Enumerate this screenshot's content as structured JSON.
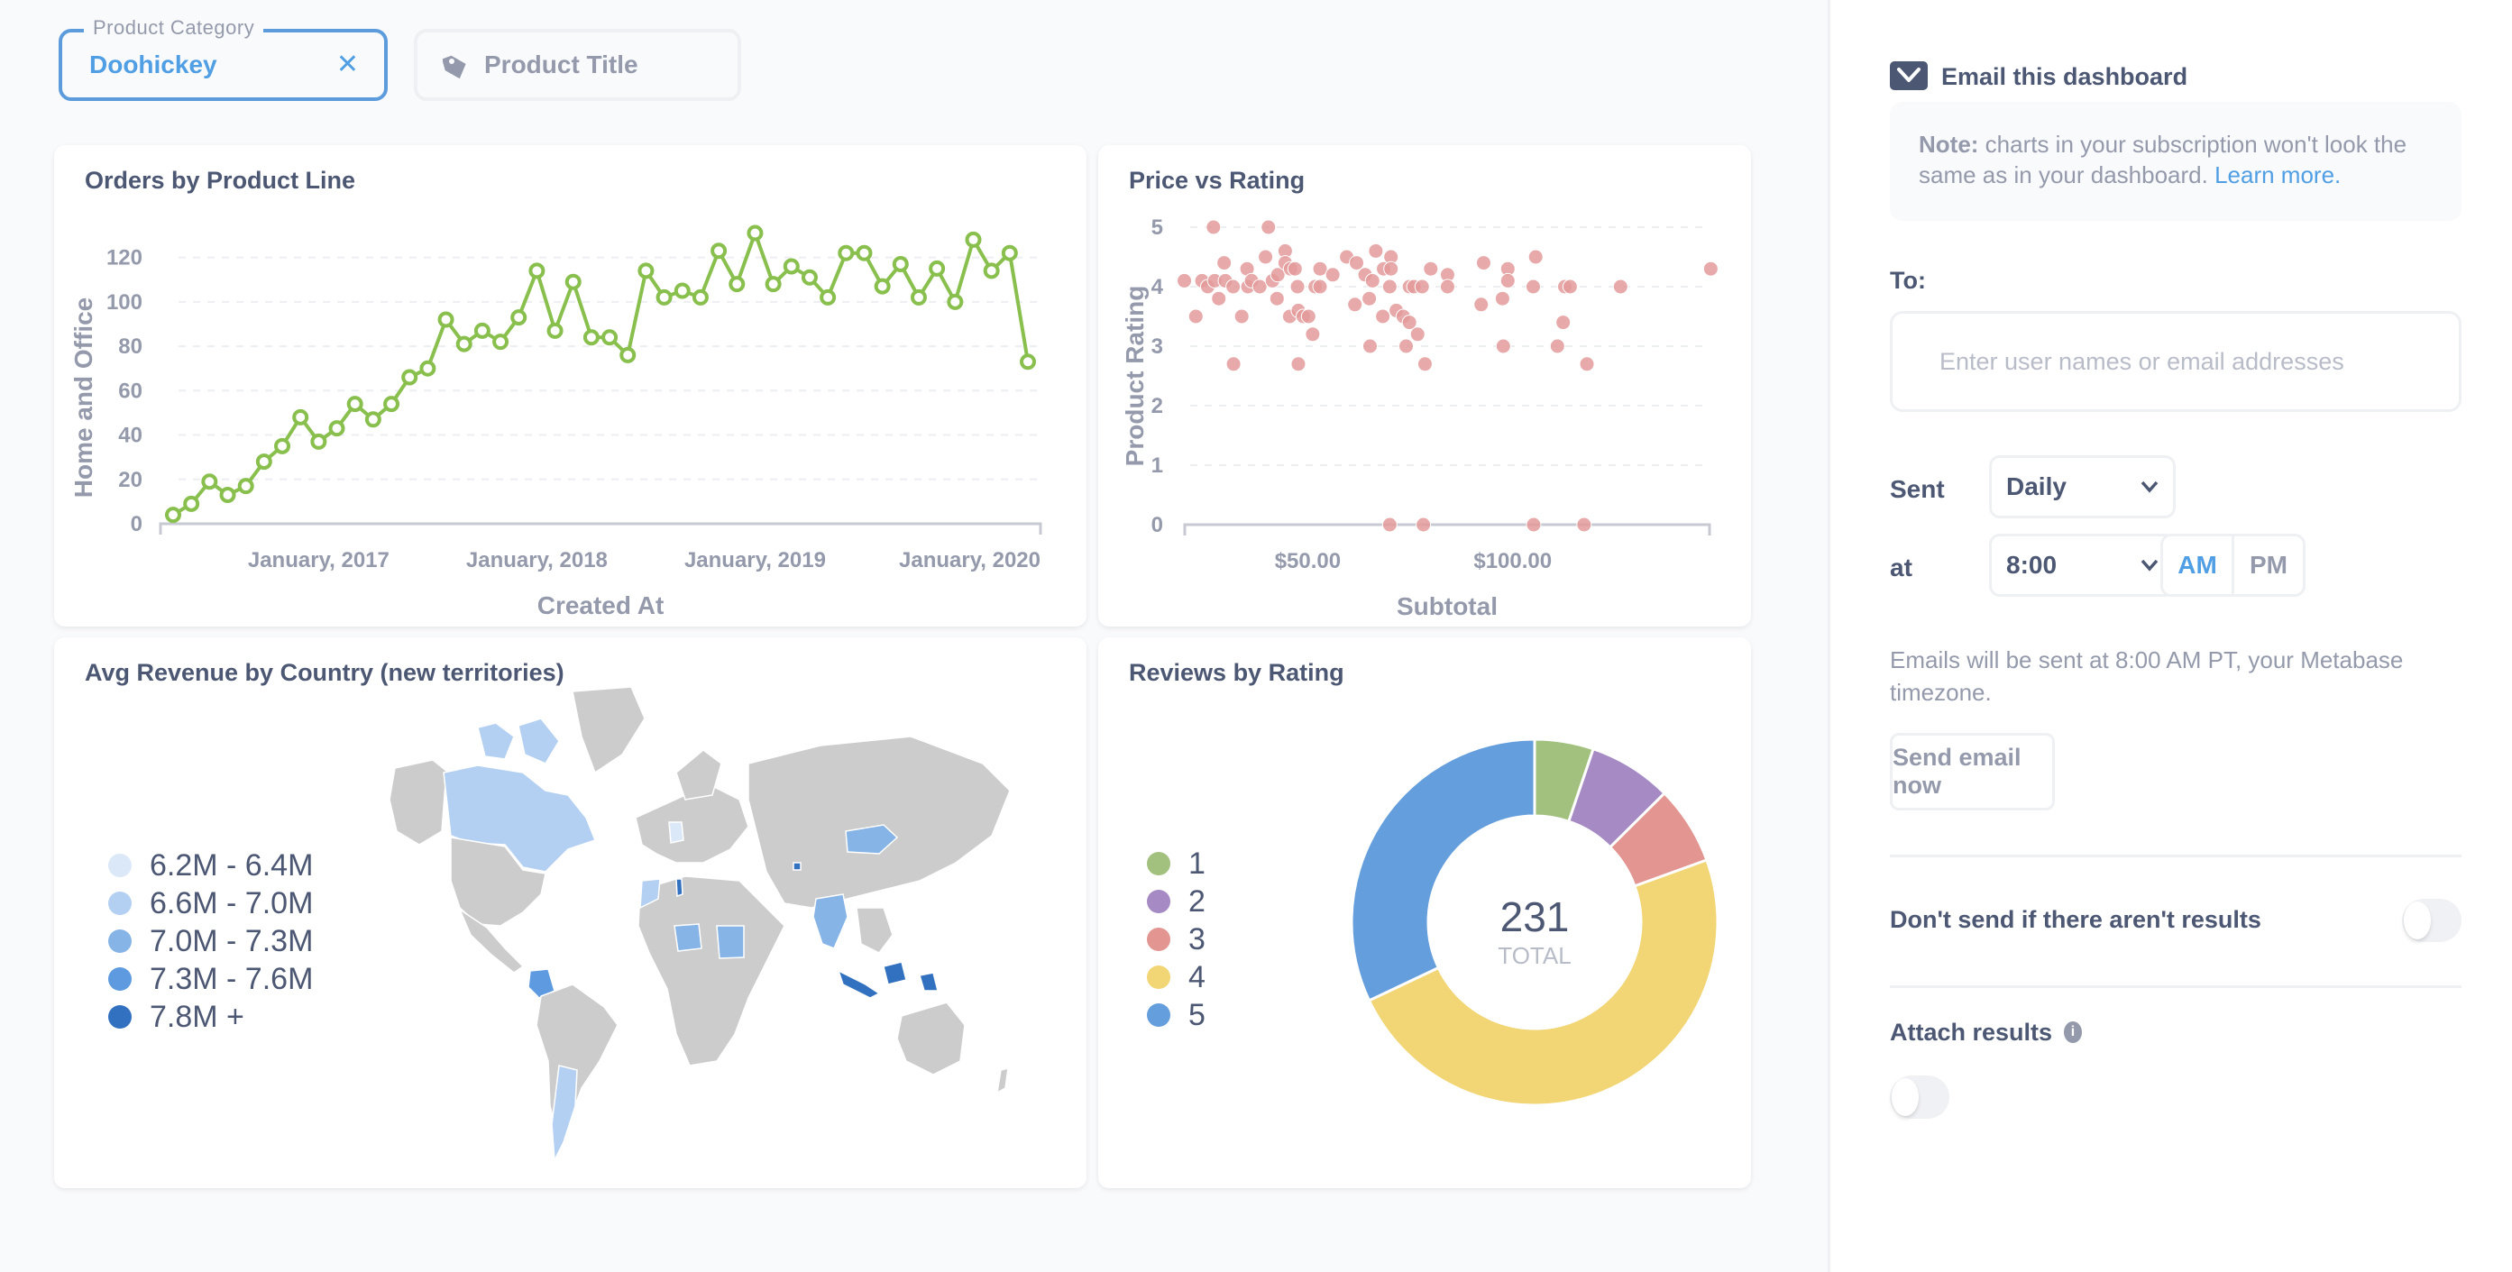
{
  "filters": [
    {
      "label": "Product Category",
      "value": "Doohickey",
      "clear_icon": "close-icon",
      "active": true
    },
    {
      "placeholder": "Product Title",
      "icon": "tag-icon",
      "active": false
    }
  ],
  "cards": {
    "line": {
      "title": "Orders by Product Line"
    },
    "scatter": {
      "title": "Price vs Rating"
    },
    "map": {
      "title": "Avg Revenue by Country (new territories)"
    },
    "donut": {
      "title": "Reviews by Rating"
    }
  },
  "chart_data": [
    {
      "type": "line",
      "title": "Orders by Product Line",
      "xlabel": "Created At",
      "ylabel": "Home and Office",
      "ylim": [
        0,
        130
      ],
      "yticks": [
        0,
        20,
        40,
        60,
        80,
        100,
        120
      ],
      "xticks": [
        "January, 2017",
        "January, 2018",
        "January, 2019",
        "January, 2020"
      ],
      "x_start": "2016-05",
      "x_end": "2020-04",
      "grid": "horizontal-dashed",
      "color": "#88bf4d",
      "series": [
        {
          "name": "Home and Office",
          "values": [
            4,
            9,
            19,
            13,
            17,
            28,
            35,
            48,
            37,
            43,
            54,
            47,
            54,
            66,
            70,
            92,
            81,
            87,
            82,
            93,
            114,
            87,
            109,
            84,
            84,
            76,
            114,
            102,
            105,
            102,
            123,
            108,
            131,
            108,
            116,
            111,
            102,
            122,
            122,
            107,
            117,
            102,
            115,
            100,
            128,
            114,
            122,
            73
          ]
        }
      ]
    },
    {
      "type": "scatter",
      "title": "Price vs Rating",
      "xlabel": "Subtotal",
      "ylabel": "Product Rating",
      "xlim": [
        20,
        148
      ],
      "ylim": [
        0,
        5
      ],
      "xticks": [
        "$50.00",
        "$100.00"
      ],
      "xtick_values": [
        50,
        100
      ],
      "yticks": [
        0,
        1,
        2,
        3,
        4,
        5
      ],
      "grid": "horizontal-dashed",
      "color": "#e39a9a",
      "points": [
        [
          19.9,
          4.1
        ],
        [
          22.7,
          3.5
        ],
        [
          24.2,
          4.1
        ],
        [
          25.6,
          4.0
        ],
        [
          27.0,
          5.0
        ],
        [
          27.3,
          4.1
        ],
        [
          28.3,
          3.8
        ],
        [
          29.6,
          4.4
        ],
        [
          29.9,
          4.1
        ],
        [
          31.8,
          4.0
        ],
        [
          31.9,
          2.7
        ],
        [
          33.9,
          3.5
        ],
        [
          35.2,
          4.3
        ],
        [
          35.4,
          4.0
        ],
        [
          36.3,
          4.1
        ],
        [
          38.3,
          4.0
        ],
        [
          39.7,
          4.5
        ],
        [
          40.4,
          5.0
        ],
        [
          41.4,
          4.1
        ],
        [
          42.5,
          3.8
        ],
        [
          42.7,
          4.2
        ],
        [
          44.5,
          4.6
        ],
        [
          44.5,
          4.4
        ],
        [
          45.6,
          3.5
        ],
        [
          45.8,
          4.3
        ],
        [
          46.9,
          4.3
        ],
        [
          47.5,
          4.0
        ],
        [
          47.7,
          2.7
        ],
        [
          47.7,
          3.6
        ],
        [
          48.9,
          3.5
        ],
        [
          50.2,
          3.5
        ],
        [
          51.2,
          3.2
        ],
        [
          51.8,
          4.0
        ],
        [
          53.0,
          4.0
        ],
        [
          53.0,
          4.3
        ],
        [
          56.1,
          4.2
        ],
        [
          59.5,
          4.5
        ],
        [
          61.5,
          3.7
        ],
        [
          61.9,
          4.4
        ],
        [
          64.0,
          4.2
        ],
        [
          65.0,
          3.8
        ],
        [
          65.2,
          3.0
        ],
        [
          65.8,
          4.1
        ],
        [
          66.6,
          4.6
        ],
        [
          68.3,
          3.5
        ],
        [
          68.5,
          4.3
        ],
        [
          70.0,
          4.0
        ],
        [
          70.0,
          0
        ],
        [
          70.3,
          4.5
        ],
        [
          70.3,
          4.3
        ],
        [
          71.6,
          3.6
        ],
        [
          73.3,
          3.5
        ],
        [
          74.0,
          3.0
        ],
        [
          74.8,
          3.4
        ],
        [
          74.8,
          4.0
        ],
        [
          75.9,
          4.0
        ],
        [
          76.8,
          3.2
        ],
        [
          77.9,
          4.0
        ],
        [
          78.2,
          0
        ],
        [
          78.6,
          2.7
        ],
        [
          80.0,
          4.3
        ],
        [
          84.1,
          4.2
        ],
        [
          84.1,
          4.0
        ],
        [
          92.3,
          3.7
        ],
        [
          92.9,
          4.4
        ],
        [
          97.5,
          3.8
        ],
        [
          97.7,
          3.0
        ],
        [
          98.8,
          4.3
        ],
        [
          98.8,
          4.1
        ],
        [
          105.0,
          4.0
        ],
        [
          105.1,
          0
        ],
        [
          105.6,
          4.5
        ],
        [
          110.9,
          3.0
        ],
        [
          112.3,
          3.4
        ],
        [
          112.7,
          4.0
        ],
        [
          114.0,
          4.0
        ],
        [
          117.4,
          0
        ],
        [
          118.1,
          2.7
        ],
        [
          126.3,
          4.0
        ],
        [
          148.3,
          4.3
        ]
      ]
    },
    {
      "type": "map",
      "title": "Avg Revenue by Country (new territories)",
      "legend": [
        {
          "label": "6.2M - 6.4M",
          "color": "#dbe8f8"
        },
        {
          "label": "6.6M - 7.0M",
          "color": "#b3d0f2"
        },
        {
          "label": "7.0M - 7.3M",
          "color": "#86b4e6"
        },
        {
          "label": "7.3M - 7.6M",
          "color": "#5e9ae0"
        },
        {
          "label": "7.8M +",
          "color": "#3271c0"
        }
      ],
      "legend_position": "left",
      "no_data_color": "#cccccc"
    },
    {
      "type": "pie",
      "title": "Reviews by Rating",
      "categories": [
        "1",
        "2",
        "3",
        "4",
        "5"
      ],
      "values": [
        12,
        17,
        16,
        112,
        74
      ],
      "colors": [
        "#a2c07e",
        "#a68ac4",
        "#e39591",
        "#f2d574",
        "#659edc"
      ],
      "total": "231",
      "total_label": "TOTAL",
      "legend_position": "left"
    }
  ],
  "sidebar": {
    "email_checkbox_label": "Email this dashboard",
    "note_bold": "Note:",
    "note_text": " charts in your subscription won't look the same as in your dashboard. ",
    "note_link": "Learn more.",
    "to_label": "To:",
    "to_placeholder": "Enter user names or email addresses",
    "sent_label": "Sent",
    "frequency_value": "Daily",
    "at_label": "at",
    "time_value": "8:00",
    "am_label": "AM",
    "pm_label": "PM",
    "am_selected": true,
    "timezone_note": "Emails will be sent at 8:00 AM PT, your Metabase timezone.",
    "send_now_label": "Send email now",
    "skip_if_empty_label": "Don't send if there aren't results",
    "skip_if_empty_on": false,
    "attach_results_label": "Attach results",
    "attach_results_on": false
  }
}
